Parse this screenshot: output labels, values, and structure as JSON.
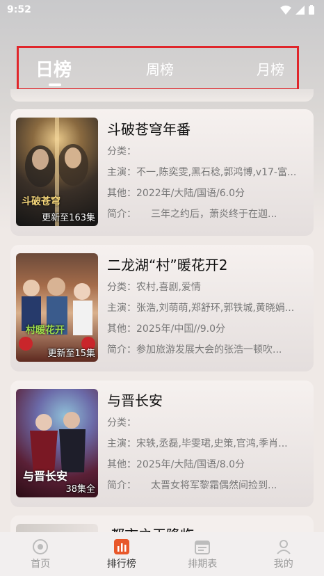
{
  "status_bar": {
    "time": "9:52"
  },
  "tabs": [
    {
      "label": "日榜",
      "active": true
    },
    {
      "label": "周榜",
      "active": false
    },
    {
      "label": "月榜",
      "active": false
    }
  ],
  "labels": {
    "category": "分类：",
    "cast": "主演：",
    "other": "其他：",
    "summary": "简介："
  },
  "items": [
    {
      "title": "斗破苍穹年番",
      "category": "",
      "cast": "不一,陈奕雯,黑石稔,郭鸿博,v17-富...",
      "other": "2022年/大陆/国语/6.0分",
      "summary": "　　三年之约后，萧炎终于在迦...",
      "badge": "更新至163集",
      "poster_title": "斗破苍穹"
    },
    {
      "title": "二龙湖“村”暖花开2",
      "category": "农村,喜剧,爱情",
      "cast": "张浩,刘萌萌,郑舒环,郭铁城,黄晓娟...",
      "other": "2025年/中国//9.0分",
      "summary": "参加旅游发展大会的张浩一顿吹...",
      "badge": "更新至15集",
      "poster_title": "村暖花开"
    },
    {
      "title": "与晋长安",
      "category": "",
      "cast": "宋轶,丞磊,毕雯珺,史策,官鸿,季肖...",
      "other": "2025年/大陆/国语/8.0分",
      "summary": "　　太晋女将军黎霜偶然间捡到...",
      "badge": "38集全",
      "poster_title": "与晋长安"
    }
  ],
  "partial_item": {
    "title": "都市之王降临"
  },
  "bottom_nav": [
    {
      "label": "首页",
      "icon": "home-icon",
      "active": false
    },
    {
      "label": "排行榜",
      "icon": "ranking-icon",
      "active": true
    },
    {
      "label": "排期表",
      "icon": "calendar-icon",
      "active": false
    },
    {
      "label": "我的",
      "icon": "user-icon",
      "active": false
    }
  ],
  "colors": {
    "highlight_border": "#e0262b",
    "ranking_active": "#e8572a"
  }
}
